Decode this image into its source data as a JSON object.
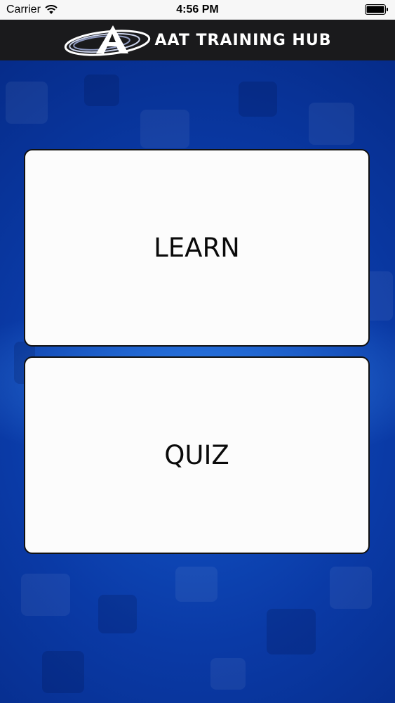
{
  "status_bar": {
    "carrier": "Carrier",
    "time": "4:56 PM"
  },
  "header": {
    "logo_text": "AAT TRAINING HUB"
  },
  "menu": {
    "learn_label": "LEARN",
    "quiz_label": "QUIZ"
  },
  "colors": {
    "background_blue": "#0b3aa8",
    "header_dark": "#1a1a1c",
    "card_white": "#fcfcfc"
  }
}
